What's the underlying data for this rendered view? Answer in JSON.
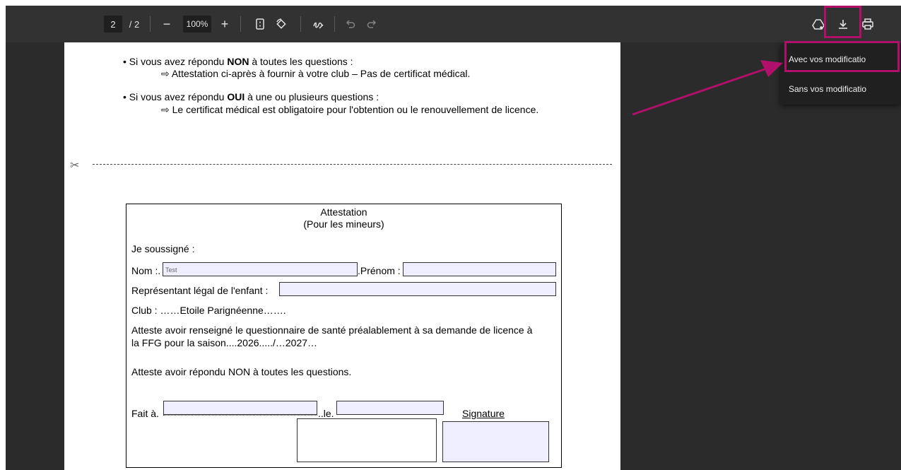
{
  "toolbar": {
    "current_page": "2",
    "page_separator": "/ 2",
    "zoom_out": "−",
    "zoom_value": "100%",
    "zoom_in": "+",
    "icons": [
      "fit-page-icon",
      "rotate-icon",
      "draw-icon",
      "undo-icon",
      "redo-icon",
      "save-to-drive-icon",
      "download-icon",
      "print-icon"
    ]
  },
  "download_menu": {
    "items": [
      "Avec vos modificatio",
      "Sans vos modificatio"
    ]
  },
  "document": {
    "bullet1": {
      "prefix": "• Si vous avez répondu ",
      "bold": "NON",
      "suffix": " à toutes les questions :",
      "sub": "⇨ Attestation ci-après à fournir à votre club – Pas de certificat médical."
    },
    "bullet2": {
      "prefix": "• Si vous avez répondu ",
      "bold": "OUI",
      "suffix": " à une ou plusieurs questions :",
      "sub": "⇨ Le certificat médical est obligatoire pour l'obtention ou le renouvellement de licence."
    },
    "attestation": {
      "title": "Attestation",
      "subtitle": "(Pour les mineurs)",
      "soussigne": "Je soussigné :",
      "nom_label": "Nom :.",
      "nom_value": "Test",
      "prenom_label": ".Prénom :",
      "representant_label": "Représentant légal de l'enfant :",
      "club": "Club : ……Etoile Parignéenne…….",
      "atteste1_line1": "Atteste avoir renseigné le questionnaire de santé préalablement à sa demande de licence à",
      "atteste1_line2": "la FFG pour la saison....2026...../…2027…",
      "atteste2": "Atteste avoir répondu NON à toutes les questions.",
      "fait_label": "Fait à.",
      "le_label": "..le.",
      "signature_label": "Signature"
    }
  },
  "colors": {
    "highlight": "#b0106a",
    "toolbar_bg": "#323232",
    "viewer_bg": "#2b2b2b",
    "field_bg": "#eeeeff"
  }
}
